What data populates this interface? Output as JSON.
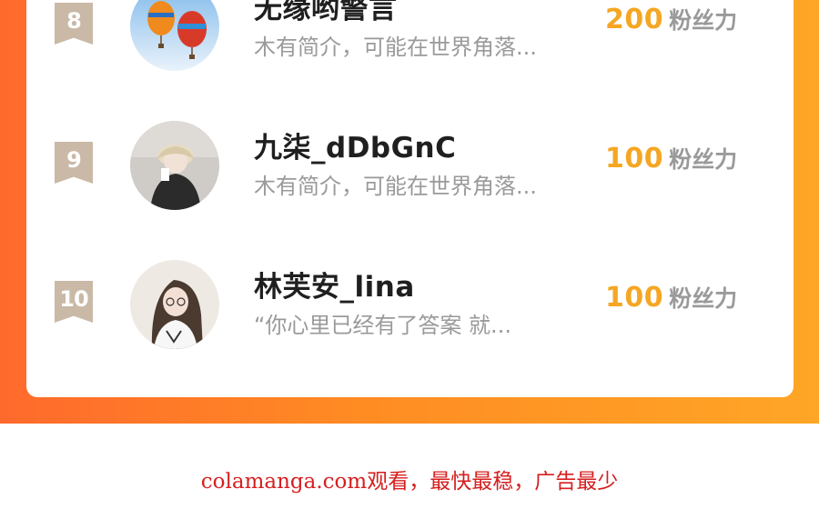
{
  "ranking": {
    "entries": [
      {
        "rank": "8",
        "name": "无缘哟警言",
        "bio": "木有简介，可能在世界角落...",
        "score": "200",
        "unit": "粉丝力"
      },
      {
        "rank": "9",
        "name": "九柒_dDbGnC",
        "bio": "木有简介，可能在世界角落...",
        "score": "100",
        "unit": "粉丝力"
      },
      {
        "rank": "10",
        "name": "林芙安_lina",
        "bio": "“你心里已经有了答案 就...",
        "score": "100",
        "unit": "粉丝力"
      }
    ]
  },
  "footer": {
    "text": "colamanga.com观看，最快最稳，广告最少"
  },
  "colors": {
    "accent": "#f5a623",
    "banner_start": "#ff6a2c",
    "banner_end": "#ffa626",
    "footer": "#d61f1f"
  }
}
